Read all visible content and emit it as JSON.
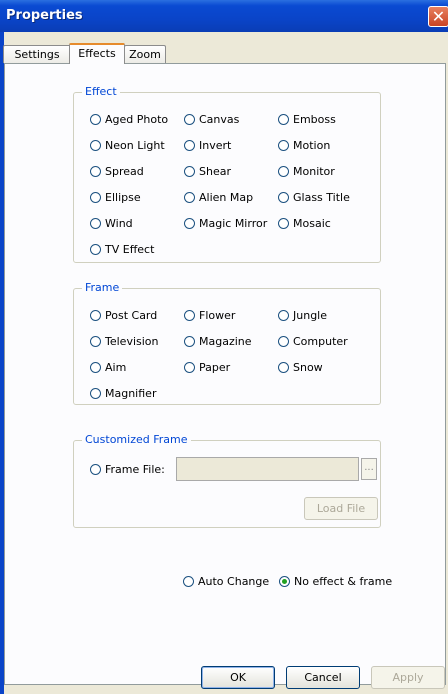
{
  "window": {
    "title": "Properties",
    "close_symbol": "✕"
  },
  "tabs": [
    {
      "label": "Settings"
    },
    {
      "label": "Effects"
    },
    {
      "label": "Zoom"
    }
  ],
  "effect": {
    "legend": "Effect",
    "options": [
      "Aged Photo",
      "Canvas",
      "Emboss",
      "Neon Light",
      "Invert",
      "Motion",
      "Spread",
      "Shear",
      "Monitor",
      "Ellipse",
      "Alien Map",
      "Glass Title",
      "Wind",
      "Magic Mirror",
      "Mosaic",
      "TV Effect"
    ]
  },
  "frame": {
    "legend": "Frame",
    "options": [
      "Post Card",
      "Flower",
      "Jungle",
      "Television",
      "Magazine",
      "Computer",
      "Aim",
      "Paper",
      "Snow",
      "Magnifier"
    ]
  },
  "customized": {
    "legend": "Customized Frame",
    "frame_file_label": "Frame File:",
    "frame_file_value": "",
    "browse_label": "...",
    "load_file_label": "Load File"
  },
  "mode": {
    "auto_change_label": "Auto Change",
    "no_effect_label": "No effect & frame",
    "selected": "no_effect"
  },
  "buttons": {
    "ok": "OK",
    "cancel": "Cancel",
    "apply": "Apply"
  }
}
